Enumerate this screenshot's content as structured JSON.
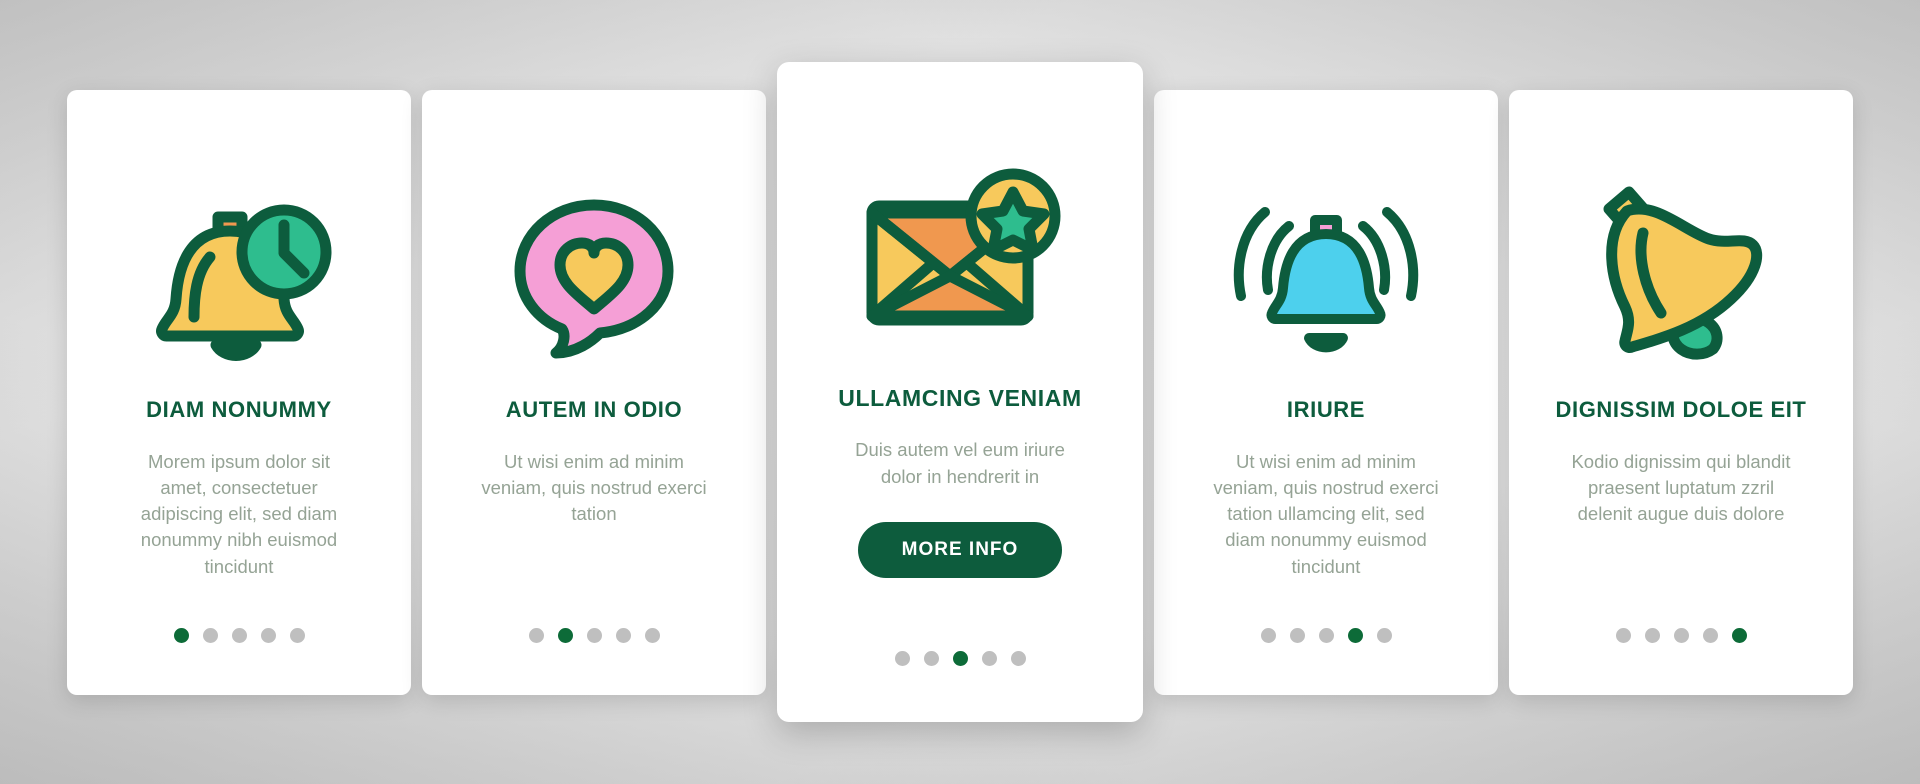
{
  "theme": {
    "green_dark": "#0d5c3d",
    "green_dot": "#0d6b38",
    "gray_dot": "#bfbfbf",
    "body_text": "#95a395",
    "card_bg": "#ffffff",
    "page_bg": "#d9d9d9",
    "yellow": "#f7c95c",
    "orange": "#f0984f",
    "pink": "#f5a0d8",
    "pink_bubble": "#f59fd6",
    "cyan": "#4dd0ed",
    "teal": "#2ebd8e"
  },
  "cards": [
    {
      "icon": "bell-clock-icon",
      "title": "DIAM NONUMMY",
      "body": "Morem ipsum dolor sit amet, consectetuer adipiscing elit, sed diam nonummy nibh euismod tincidunt",
      "dots": {
        "count": 5,
        "active": 0
      },
      "featured": false,
      "button": null
    },
    {
      "icon": "speech-bubble-heart-icon",
      "title": "AUTEM IN ODIO",
      "body": "Ut wisi enim ad minim veniam, quis nostrud exerci tation",
      "dots": {
        "count": 5,
        "active": 1
      },
      "featured": false,
      "button": null
    },
    {
      "icon": "envelope-star-icon",
      "title": "ULLAMCING VENIAM",
      "body": "Duis autem vel eum iriure dolor in hendrerit in",
      "dots": {
        "count": 5,
        "active": 2
      },
      "featured": true,
      "button": "MORE INFO"
    },
    {
      "icon": "ringing-bell-icon",
      "title": "IRIURE",
      "body": "Ut wisi enim ad minim veniam, quis nostrud exerci tation ullamcing elit, sed diam nonummy euismod tincidunt",
      "dots": {
        "count": 5,
        "active": 3
      },
      "featured": false,
      "button": null
    },
    {
      "icon": "tilted-bell-icon",
      "title": "DIGNISSIM DOLOE EIT",
      "body": "Kodio dignissim qui blandit praesent luptatum zzril delenit augue duis dolore",
      "dots": {
        "count": 5,
        "active": 4
      },
      "featured": false,
      "button": null
    }
  ]
}
